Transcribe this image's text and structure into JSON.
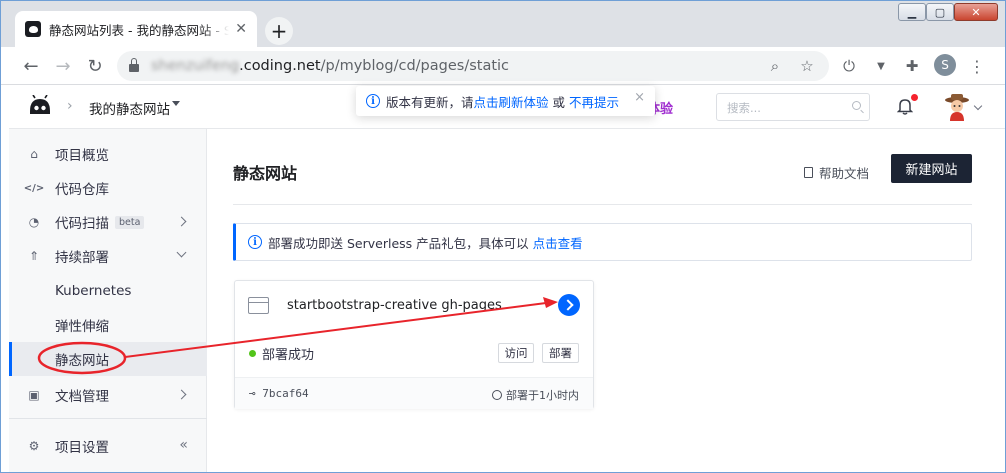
{
  "browser": {
    "tab_title": "静态网站列表 - 我的静态网站 - S",
    "url_blurred": "shenzuifeng",
    "url_host": ".coding.net",
    "url_path": "/p/myblog/cd/pages/static",
    "profile_initial": "S"
  },
  "header": {
    "project_name": "我的静态网站",
    "promo_text": "体验",
    "search_placeholder": "搜索..."
  },
  "toast": {
    "message": "版本有更新，请",
    "refresh_link": "点击刷新体验",
    "or": "或",
    "dismiss_link": "不再提示"
  },
  "sidebar": {
    "items": [
      {
        "label": "项目概览",
        "icon": "home-icon"
      },
      {
        "label": "代码仓库",
        "icon": "code-icon"
      },
      {
        "label": "代码扫描",
        "icon": "scan-icon",
        "badge": "beta"
      },
      {
        "label": "持续部署",
        "icon": "rocket-icon"
      },
      {
        "label": "Kubernetes"
      },
      {
        "label": "弹性伸缩"
      },
      {
        "label": "静态网站"
      },
      {
        "label": "文档管理",
        "icon": "book-icon"
      },
      {
        "label": "项目设置",
        "icon": "gear-icon"
      }
    ],
    "collapse_glyph": "«"
  },
  "main": {
    "title": "静态网站",
    "help_label": "帮助文档",
    "new_button": "新建网站",
    "notice_text": "部署成功即送 Serverless 产品礼包，具体可以",
    "notice_link": "点击查看",
    "card": {
      "name": "startbootstrap-creative gh-pages",
      "status": "部署成功",
      "visit": "访问",
      "deploy": "部署",
      "commit": "7bcaf64",
      "deployed_at": "部署于1小时内"
    }
  },
  "colors": {
    "accent": "#0066ff",
    "annotation_red": "#e8242b",
    "success": "#52c41a",
    "dark_button": "#1c2434"
  }
}
